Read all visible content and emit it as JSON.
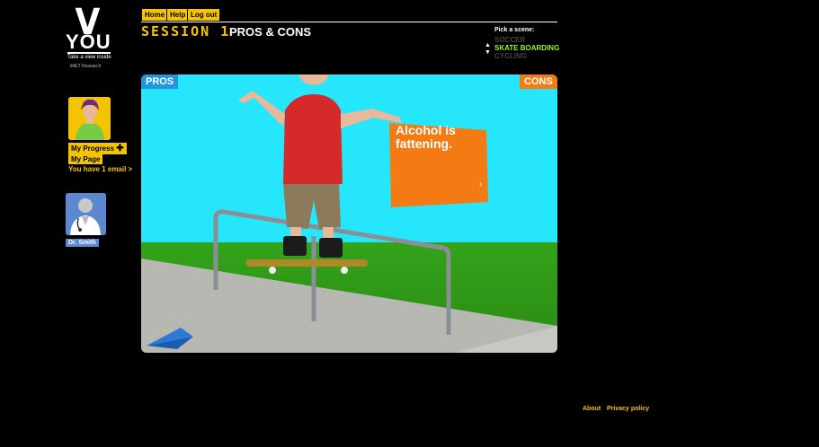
{
  "logo": {
    "letter": "V",
    "word": "YOU",
    "tagline": "Take a view inside",
    "org": "iMET Research"
  },
  "nav": {
    "home": "Home",
    "help": "Help",
    "logout": "Log out"
  },
  "session": {
    "label": "SESSION 1",
    "title": "PROS & CONS"
  },
  "scene_picker": {
    "title": "Pick a scene:",
    "options": [
      "SOCCER",
      "SKATE BOARDING",
      "CYCLING"
    ],
    "selected": "SKATE BOARDING"
  },
  "sidebar": {
    "my_progress": "My Progress",
    "my_page": "My Page",
    "email_notice": "You have 1 email >",
    "doctor": "Dr. Smith"
  },
  "tabs": {
    "pros": "PROS",
    "cons": "CONS"
  },
  "card": {
    "text": "Alcohol is fattening.",
    "color": "#f47b14"
  },
  "footer": {
    "about": "About",
    "privacy": "Privacy policy"
  },
  "colors": {
    "accent": "#f5c400",
    "pros": "#2196e0",
    "cons": "#f47b14",
    "sky": "#26e6fb",
    "doctor": "#5b88cf"
  }
}
